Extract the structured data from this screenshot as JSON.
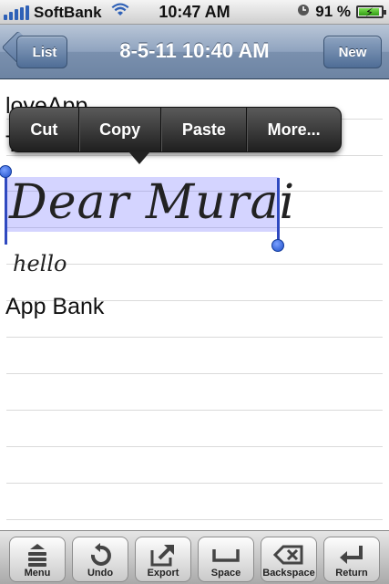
{
  "status_bar": {
    "carrier": "SoftBank",
    "time": "10:47 AM",
    "battery": "91 %",
    "battery_level": 0.91
  },
  "nav": {
    "back_label": "List",
    "title": "8-5-11 10:40 AM",
    "new_label": "New"
  },
  "note": {
    "line1": "loveApp",
    "line2": "Te",
    "handwriting_selected": "Dear Murai",
    "handwriting_small": "hello",
    "line_app_bank": "App Bank"
  },
  "edit_menu": {
    "items": [
      "Cut",
      "Copy",
      "Paste",
      "More..."
    ]
  },
  "toolbar": {
    "buttons": [
      "Menu",
      "Undo",
      "Export",
      "Space",
      "Backspace",
      "Return"
    ]
  },
  "colors": {
    "nav_bar": "#7a90ae",
    "selection": "#b7b7ff",
    "caret": "#2f49c0"
  }
}
